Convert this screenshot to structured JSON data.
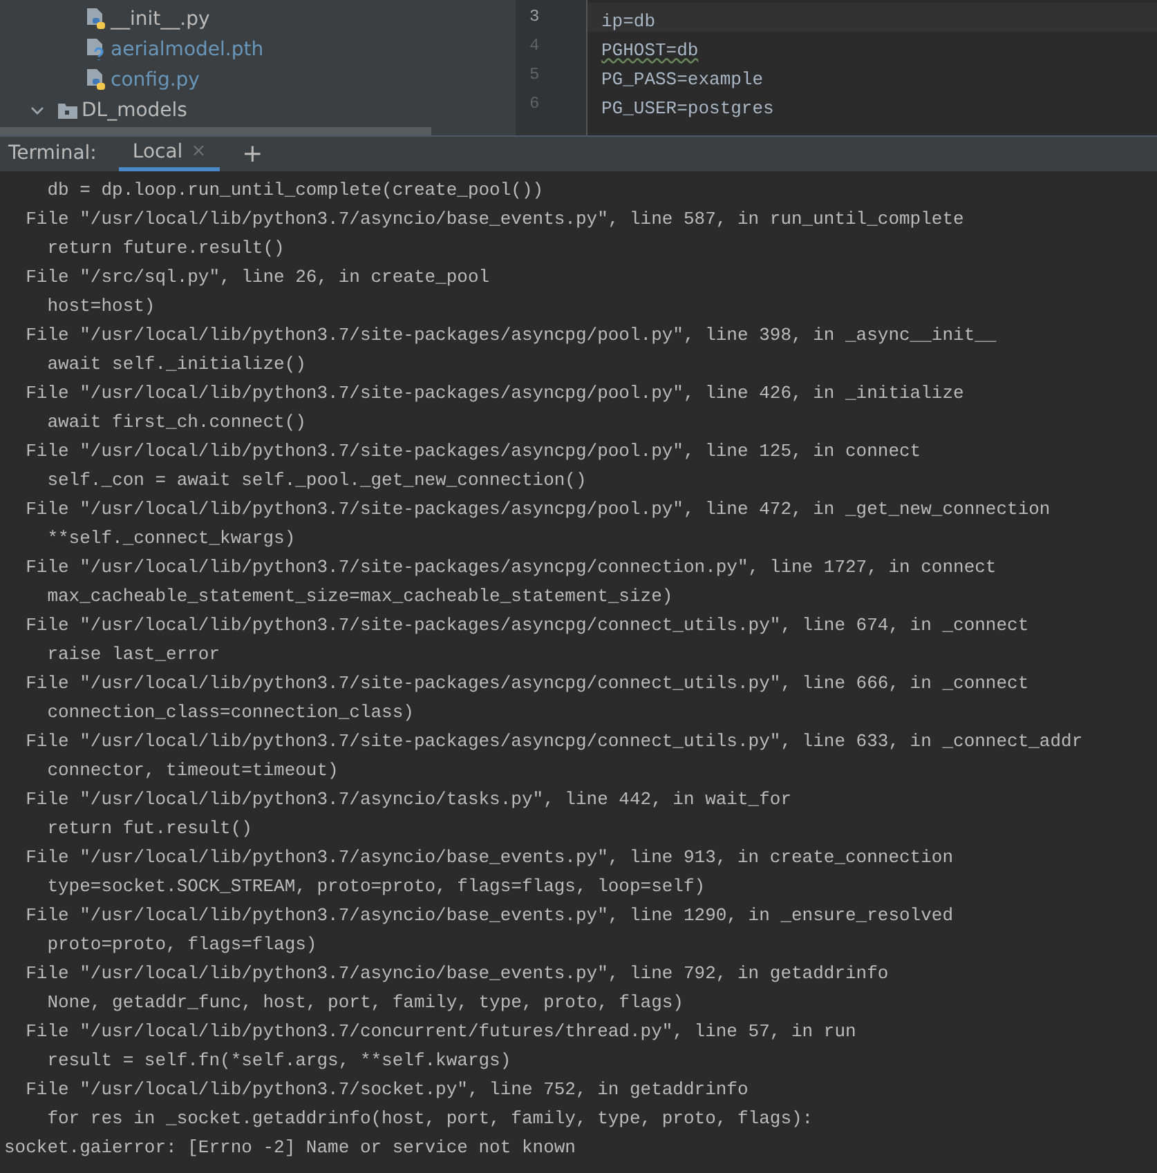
{
  "project_tree": {
    "items": [
      {
        "kind": "python",
        "label": "__init__.py",
        "color": "#bbbbbb"
      },
      {
        "kind": "unknown",
        "label": "aerialmodel.pth",
        "color": "#6897bb"
      },
      {
        "kind": "python",
        "label": "config.py",
        "color": "#6897bb"
      },
      {
        "kind": "folder",
        "label": "DL_models",
        "color": "#bbbbbb",
        "expanded": true
      }
    ]
  },
  "editor": {
    "lines": [
      {
        "number": "3",
        "text": "ip=db",
        "current": true,
        "warning": false
      },
      {
        "number": "4",
        "text": "PGHOST=db",
        "current": false,
        "warning": true
      },
      {
        "number": "5",
        "text": "PG_PASS=example",
        "current": false,
        "warning": false
      },
      {
        "number": "6",
        "text": "PG_USER=postgres",
        "current": false,
        "warning": false
      }
    ]
  },
  "terminal": {
    "title": "Terminal:",
    "tabs": [
      {
        "label": "Local",
        "selected": true,
        "close": "×"
      }
    ],
    "add": "+",
    "lines": [
      "    db = dp.loop.run_until_complete(create_pool())",
      "  File \"/usr/local/lib/python3.7/asyncio/base_events.py\", line 587, in run_until_complete",
      "    return future.result()",
      "  File \"/src/sql.py\", line 26, in create_pool",
      "    host=host)",
      "  File \"/usr/local/lib/python3.7/site-packages/asyncpg/pool.py\", line 398, in _async__init__",
      "    await self._initialize()",
      "  File \"/usr/local/lib/python3.7/site-packages/asyncpg/pool.py\", line 426, in _initialize",
      "    await first_ch.connect()",
      "  File \"/usr/local/lib/python3.7/site-packages/asyncpg/pool.py\", line 125, in connect",
      "    self._con = await self._pool._get_new_connection()",
      "  File \"/usr/local/lib/python3.7/site-packages/asyncpg/pool.py\", line 472, in _get_new_connection",
      "    **self._connect_kwargs)",
      "  File \"/usr/local/lib/python3.7/site-packages/asyncpg/connection.py\", line 1727, in connect",
      "    max_cacheable_statement_size=max_cacheable_statement_size)",
      "  File \"/usr/local/lib/python3.7/site-packages/asyncpg/connect_utils.py\", line 674, in _connect",
      "    raise last_error",
      "  File \"/usr/local/lib/python3.7/site-packages/asyncpg/connect_utils.py\", line 666, in _connect",
      "    connection_class=connection_class)",
      "  File \"/usr/local/lib/python3.7/site-packages/asyncpg/connect_utils.py\", line 633, in _connect_addr",
      "    connector, timeout=timeout)",
      "  File \"/usr/local/lib/python3.7/asyncio/tasks.py\", line 442, in wait_for",
      "    return fut.result()",
      "  File \"/usr/local/lib/python3.7/asyncio/base_events.py\", line 913, in create_connection",
      "    type=socket.SOCK_STREAM, proto=proto, flags=flags, loop=self)",
      "  File \"/usr/local/lib/python3.7/asyncio/base_events.py\", line 1290, in _ensure_resolved",
      "    proto=proto, flags=flags)",
      "  File \"/usr/local/lib/python3.7/asyncio/base_events.py\", line 792, in getaddrinfo",
      "    None, getaddr_func, host, port, family, type, proto, flags)",
      "  File \"/usr/local/lib/python3.7/concurrent/futures/thread.py\", line 57, in run",
      "    result = self.fn(*self.args, **self.kwargs)",
      "  File \"/usr/local/lib/python3.7/socket.py\", line 752, in getaddrinfo",
      "    for res in _socket.getaddrinfo(host, port, family, type, proto, flags):",
      "socket.gaierror: [Errno -2] Name or service not known"
    ]
  }
}
